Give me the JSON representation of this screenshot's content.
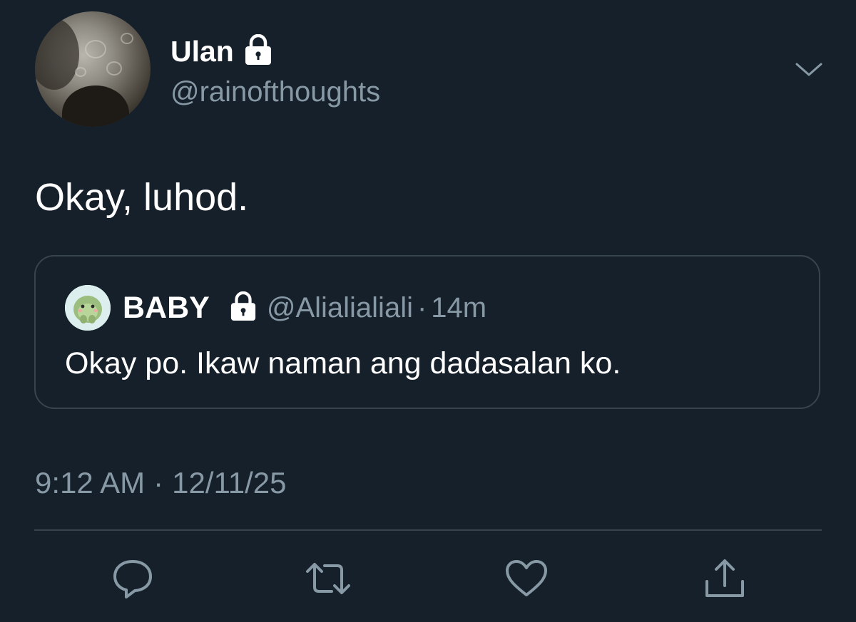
{
  "tweet": {
    "author": {
      "display_name": "Ulan",
      "handle": "@rainofthoughts",
      "protected": true,
      "avatar_icon": "rainy-window-photo-avatar"
    },
    "text": "Okay, luhod.",
    "timestamp": "9:12 AM",
    "separator": "·",
    "date": "12/11/25"
  },
  "quoted_tweet": {
    "author": {
      "display_name": "BABY",
      "handle": "@Alialialiali",
      "protected": true,
      "avatar_icon": "green-cartoon-avatar"
    },
    "separator": "·",
    "time_ago": "14m",
    "text": "Okay po. Ikaw naman ang dadasalan ko."
  },
  "actions": [
    {
      "name": "reply",
      "icon": "reply-icon"
    },
    {
      "name": "retweet",
      "icon": "retweet-icon"
    },
    {
      "name": "like",
      "icon": "heart-icon"
    },
    {
      "name": "share",
      "icon": "share-icon"
    }
  ],
  "colors": {
    "background": "#16202b",
    "primary_text": "#ffffff",
    "secondary_text": "#8899a6",
    "border": "#38444d"
  }
}
